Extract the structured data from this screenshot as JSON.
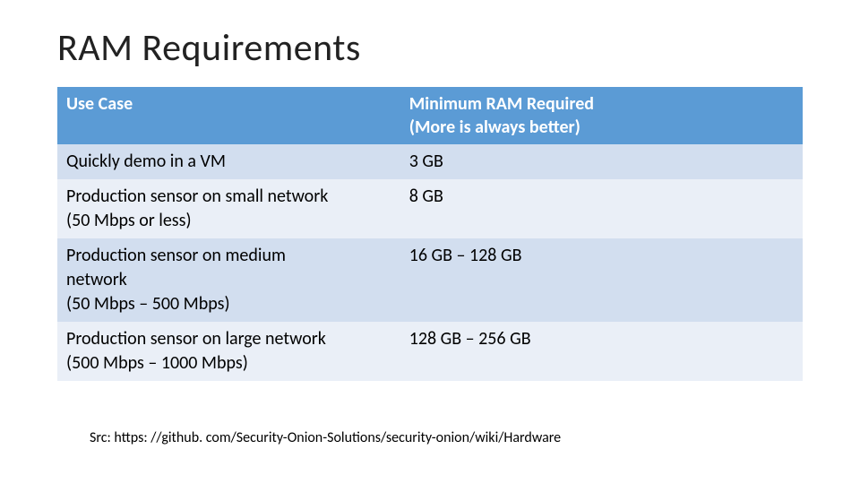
{
  "title": "RAM Requirements",
  "table": {
    "headers": {
      "use_case": "Use Case",
      "min_ram_l1": "Minimum RAM Required",
      "min_ram_l2": "(More is always better)"
    },
    "rows": [
      {
        "use_case_l1": "Quickly demo in a VM",
        "use_case_l2": "",
        "use_case_l3": "",
        "ram": "3 GB"
      },
      {
        "use_case_l1": "Production sensor on small network",
        "use_case_l2": "(50 Mbps or less)",
        "use_case_l3": "",
        "ram": "8 GB"
      },
      {
        "use_case_l1": "Production sensor on medium",
        "use_case_l2": "network",
        "use_case_l3": "(50 Mbps – 500 Mbps)",
        "ram": "16 GB – 128 GB"
      },
      {
        "use_case_l1": "Production sensor on large network",
        "use_case_l2": "(500 Mbps – 1000 Mbps)",
        "use_case_l3": "",
        "ram": "128 GB – 256 GB"
      }
    ]
  },
  "source_label": "Src: https: //github. com/Security-Onion-Solutions/security-onion/wiki/Hardware"
}
